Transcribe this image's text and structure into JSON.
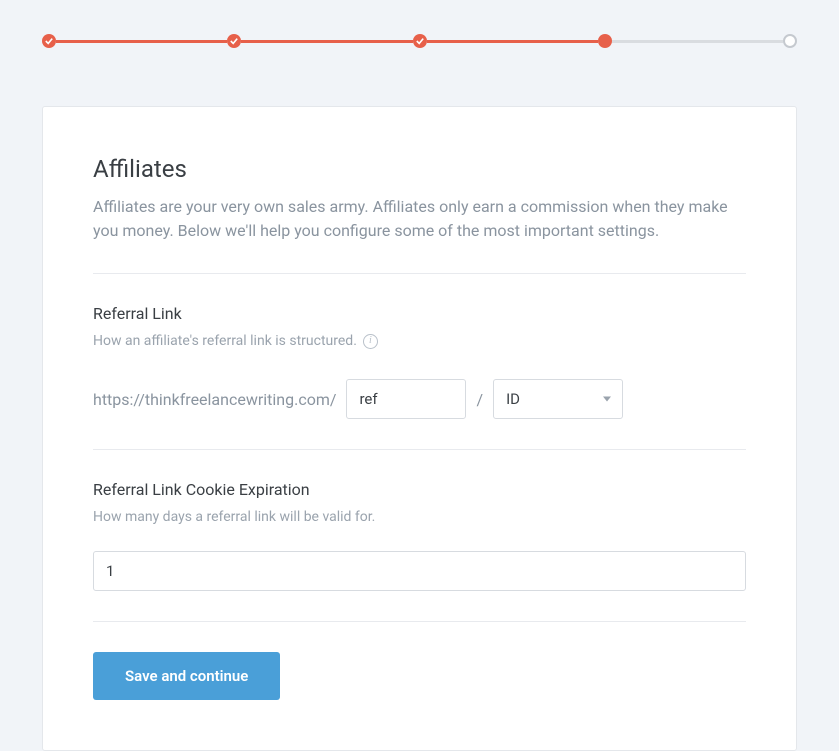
{
  "progress": {
    "steps": [
      {
        "state": "done"
      },
      {
        "state": "done"
      },
      {
        "state": "done"
      },
      {
        "state": "current"
      },
      {
        "state": "pending"
      }
    ]
  },
  "card": {
    "title": "Affiliates",
    "description": "Affiliates are your very own sales army. Affiliates only earn a commission when they make you money. Below we'll help you configure some of the most important settings."
  },
  "referralLink": {
    "title": "Referral Link",
    "hint": "How an affiliate's referral link is structured.",
    "baseUrl": "https://thinkfreelancewriting.com/",
    "paramValue": "ref",
    "separator": "/",
    "idTypeValue": "ID"
  },
  "cookieExpiration": {
    "title": "Referral Link Cookie Expiration",
    "hint": "How many days a referral link will be valid for.",
    "value": "1"
  },
  "actions": {
    "saveLabel": "Save and continue"
  }
}
